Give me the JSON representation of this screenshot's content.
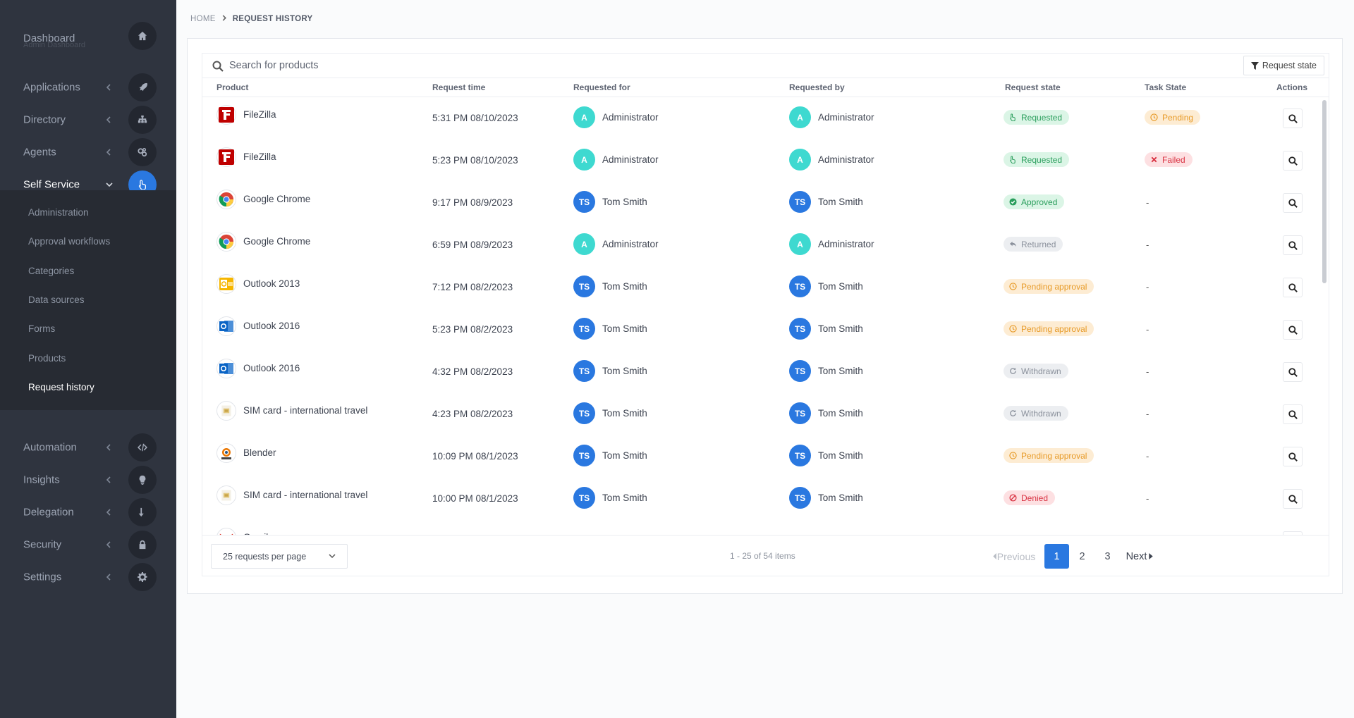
{
  "sidebar": {
    "dashboard": {
      "label": "Dashboard",
      "sublabel": "Admin Dashboard"
    },
    "items": [
      {
        "label": "Applications",
        "icon": "rocket-icon"
      },
      {
        "label": "Directory",
        "icon": "sitemap-icon"
      },
      {
        "label": "Agents",
        "icon": "cogs-icon"
      },
      {
        "label": "Self Service",
        "icon": "hand-pointer-icon"
      },
      {
        "label": "Automation",
        "icon": "code-icon"
      },
      {
        "label": "Insights",
        "icon": "lightbulb-icon"
      },
      {
        "label": "Delegation",
        "icon": "arrow-turn-down-icon"
      },
      {
        "label": "Security",
        "icon": "lock-icon"
      },
      {
        "label": "Settings",
        "icon": "gear-icon"
      }
    ],
    "submenu": [
      "Administration",
      "Approval workflows",
      "Categories",
      "Data sources",
      "Forms",
      "Products",
      "Request history"
    ]
  },
  "breadcrumb": {
    "home": "HOME",
    "current": "REQUEST HISTORY"
  },
  "search": {
    "placeholder": "Search for products"
  },
  "filter": {
    "label": "Request state"
  },
  "columns": {
    "product": "Product",
    "time": "Request time",
    "for": "Requested for",
    "by": "Requested by",
    "state": "Request state",
    "task": "Task State",
    "actions": "Actions"
  },
  "rows": [
    {
      "product": "FileZilla",
      "icon": "filezilla-icon",
      "time": "5:31 PM 08/10/2023",
      "for_initials": "A",
      "for_name": "Administrator",
      "by_initials": "A",
      "by_name": "Administrator",
      "state": "Requested",
      "task": "Pending"
    },
    {
      "product": "FileZilla",
      "icon": "filezilla-icon",
      "time": "5:23 PM 08/10/2023",
      "for_initials": "A",
      "for_name": "Administrator",
      "by_initials": "A",
      "by_name": "Administrator",
      "state": "Requested",
      "task": "Failed"
    },
    {
      "product": "Google Chrome",
      "icon": "chrome-icon",
      "time": "9:17 PM 08/9/2023",
      "for_initials": "TS",
      "for_name": "Tom Smith",
      "by_initials": "TS",
      "by_name": "Tom Smith",
      "state": "Approved",
      "task": "-"
    },
    {
      "product": "Google Chrome",
      "icon": "chrome-icon",
      "time": "6:59 PM 08/9/2023",
      "for_initials": "A",
      "for_name": "Administrator",
      "by_initials": "A",
      "by_name": "Administrator",
      "state": "Returned",
      "task": "-"
    },
    {
      "product": "Outlook 2013",
      "icon": "outlook-2013-icon",
      "time": "7:12 PM 08/2/2023",
      "for_initials": "TS",
      "for_name": "Tom Smith",
      "by_initials": "TS",
      "by_name": "Tom Smith",
      "state": "Pending approval",
      "task": "-"
    },
    {
      "product": "Outlook 2016",
      "icon": "outlook-2016-icon",
      "time": "5:23 PM 08/2/2023",
      "for_initials": "TS",
      "for_name": "Tom Smith",
      "by_initials": "TS",
      "by_name": "Tom Smith",
      "state": "Pending approval",
      "task": "-"
    },
    {
      "product": "Outlook 2016",
      "icon": "outlook-2016-icon",
      "time": "4:32 PM 08/2/2023",
      "for_initials": "TS",
      "for_name": "Tom Smith",
      "by_initials": "TS",
      "by_name": "Tom Smith",
      "state": "Withdrawn",
      "task": "-"
    },
    {
      "product": "SIM card - international travel",
      "icon": "sim-card-icon",
      "time": "4:23 PM 08/2/2023",
      "for_initials": "TS",
      "for_name": "Tom Smith",
      "by_initials": "TS",
      "by_name": "Tom Smith",
      "state": "Withdrawn",
      "task": "-"
    },
    {
      "product": "Blender",
      "icon": "blender-icon",
      "time": "10:09 PM 08/1/2023",
      "for_initials": "TS",
      "for_name": "Tom Smith",
      "by_initials": "TS",
      "by_name": "Tom Smith",
      "state": "Pending approval",
      "task": "-"
    },
    {
      "product": "SIM card - international travel",
      "icon": "sim-card-icon",
      "time": "10:00 PM 08/1/2023",
      "for_initials": "TS",
      "for_name": "Tom Smith",
      "by_initials": "TS",
      "by_name": "Tom Smith",
      "state": "Denied",
      "task": "-"
    },
    {
      "product": "Gmail",
      "icon": "gmail-icon",
      "time": "",
      "for_initials": "",
      "for_name": "",
      "by_initials": "",
      "by_name": "",
      "state": "",
      "task": ""
    }
  ],
  "pagination": {
    "per_page": "25 requests per page",
    "count": "1 - 25 of 54 items",
    "prev": "Previous",
    "pages": [
      "1",
      "2",
      "3"
    ],
    "next": "Next"
  },
  "colors": {
    "accent": "#2a78e0",
    "sidebar_bg": "#2f343f",
    "teal_avatar": "#3ed9d0"
  }
}
